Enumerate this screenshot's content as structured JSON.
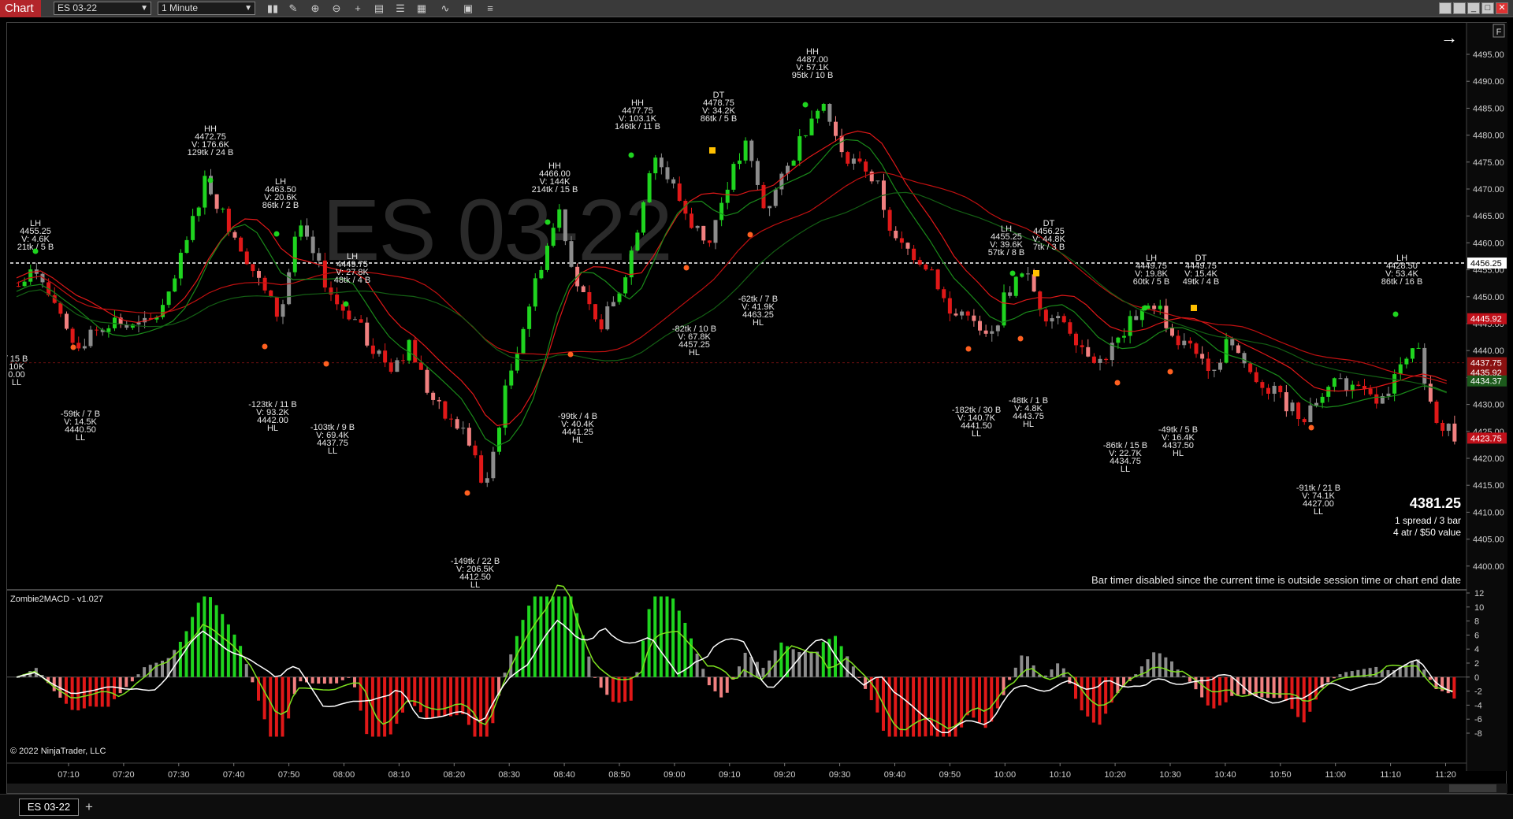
{
  "window": {
    "title": "Chart",
    "instrument": "ES 03-22",
    "interval": "1 Minute"
  },
  "toolbar_icons": [
    "bar-type-icon",
    "drawing-tool-icon",
    "zoom-in-icon",
    "zoom-out-icon",
    "crosshair-icon",
    "properties-icon",
    "templates-icon",
    "strategies-icon",
    "indicators-icon",
    "snapshot-icon",
    "menu-icon"
  ],
  "watermark": "ES 03-22",
  "price_axis": {
    "ticks": [
      "4495.00",
      "4490.00",
      "4485.00",
      "4480.00",
      "4475.00",
      "4470.00",
      "4465.00",
      "4460.00",
      "4455.00",
      "4450.00",
      "4445.00",
      "4440.00",
      "4435.00",
      "4430.00",
      "4425.00",
      "4420.00",
      "4415.00",
      "4410.00",
      "4405.00",
      "4400.00"
    ],
    "markers": [
      {
        "label": "4456.25",
        "color": "#ffffff"
      },
      {
        "label": "4445.92",
        "color": "#c0101a"
      },
      {
        "label": "4437.75",
        "color": "#8a1010"
      },
      {
        "label": "4435.92",
        "color": "#8a1010"
      },
      {
        "label": "4434.37",
        "color": "#1c5a1c"
      },
      {
        "label": "4423.75",
        "color": "#c0101a"
      }
    ]
  },
  "time_axis": [
    "07:10",
    "07:20",
    "07:30",
    "07:40",
    "07:50",
    "08:00",
    "08:10",
    "08:20",
    "08:30",
    "08:40",
    "08:50",
    "09:00",
    "09:10",
    "09:20",
    "09:30",
    "09:40",
    "09:50",
    "10:00",
    "10:10",
    "10:20",
    "10:30",
    "10:40",
    "10:50",
    "11:00",
    "11:10",
    "11:20"
  ],
  "swing_labels": [
    {
      "lines": [
        "LH",
        "4455.25",
        "V: 4.6K",
        "21tk / 5 B"
      ]
    },
    {
      "lines": [
        "HH",
        "4472.75",
        "V: 176.6K",
        "129tk / 24 B"
      ]
    },
    {
      "lines": [
        "LH",
        "4463.50",
        "V: 20.6K",
        "86tk / 2 B"
      ]
    },
    {
      "lines": [
        "LH",
        "4449.75",
        "V: 27.8K",
        "48tk / 4 B"
      ]
    },
    {
      "lines": [
        "HH",
        "4466.00",
        "V: 144K",
        "214tk / 15 B"
      ]
    },
    {
      "lines": [
        "HH",
        "4477.75",
        "V: 103.1K",
        "146tk / 11 B"
      ]
    },
    {
      "lines": [
        "DT",
        "4478.75",
        "V: 34.2K",
        "86tk / 5 B"
      ]
    },
    {
      "lines": [
        "HH",
        "4487.00",
        "V: 57.1K",
        "95tk / 10 B"
      ]
    },
    {
      "lines": [
        "LH",
        "4455.25",
        "V: 39.6K",
        "57tk / 8 B"
      ]
    },
    {
      "lines": [
        "DT",
        "4456.25",
        "V: 44.8K",
        "7tk / 3 B"
      ]
    },
    {
      "lines": [
        "LH",
        "4449.75",
        "V: 19.8K",
        "60tk / 5 B"
      ]
    },
    {
      "lines": [
        "DT",
        "4449.75",
        "V: 15.4K",
        "49tk / 4 B"
      ]
    },
    {
      "lines": [
        "LH",
        "4428.50",
        "V: 53.4K",
        "86tk / 16 B"
      ]
    },
    {
      "lines": [
        "-59tk / 7 B",
        "V: 14.5K",
        "4440.50",
        "LL"
      ]
    },
    {
      "lines": [
        "-123tk / 11 B",
        "V: 93.2K",
        "4442.00",
        "HL"
      ]
    },
    {
      "lines": [
        "-103tk / 9 B",
        "V: 69.4K",
        "4437.75",
        "LL"
      ]
    },
    {
      "lines": [
        "-149tk / 22 B",
        "V: 206.5K",
        "4412.50",
        "LL"
      ]
    },
    {
      "lines": [
        "-99tk / 4 B",
        "V: 40.4K",
        "4441.25",
        "HL"
      ]
    },
    {
      "lines": [
        "-82tk / 10 B",
        "V: 67.8K",
        "4457.25",
        "HL"
      ]
    },
    {
      "lines": [
        "-62tk / 7 B",
        "V: 41.9K",
        "4463.25",
        "HL"
      ]
    },
    {
      "lines": [
        "-182tk / 30 B",
        "V: 140.7K",
        "4441.50",
        "LL"
      ]
    },
    {
      "lines": [
        "-48tk / 1 B",
        "V: 4.8K",
        "4443.75",
        "HL"
      ]
    },
    {
      "lines": [
        "-86tk / 15 B",
        "V: 22.7K",
        "4434.75",
        "LL"
      ]
    },
    {
      "lines": [
        "-49tk / 5 B",
        "V: 16.4K",
        "4437.50",
        "HL"
      ]
    },
    {
      "lines": [
        "-91tk / 21 B",
        "V: 74.1K",
        "4427.00",
        "LL"
      ]
    },
    {
      "lines": [
        "/ 15 B",
        "10K",
        "0.00",
        "LL"
      ]
    }
  ],
  "info_box": {
    "price": "4381.25",
    "line1": "1 spread / 3 bar",
    "line2": "4 atr / $50 value"
  },
  "bar_timer": "Bar timer disabled since the current time is outside session time or chart end date",
  "indicator": {
    "name": "Zombie2MACD - v1.027",
    "ticks": [
      "12",
      "10",
      "8",
      "6",
      "4",
      "2",
      "0",
      "-2",
      "-4",
      "-6",
      "-8"
    ]
  },
  "copyright": "© 2022 NinjaTrader, LLC",
  "panel_button": "F",
  "tabs": [
    {
      "label": "ES 03-22"
    }
  ],
  "add_tab": "+"
}
